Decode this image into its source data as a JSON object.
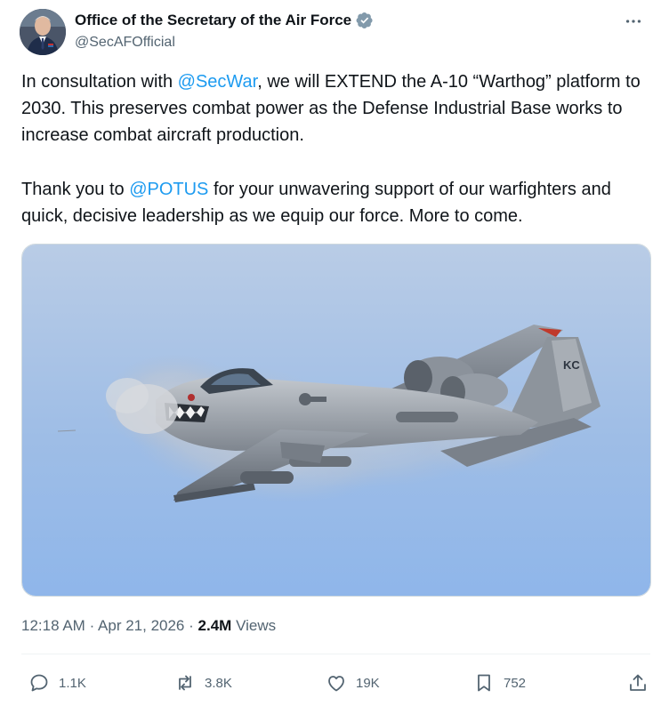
{
  "post": {
    "author": {
      "display_name": "Office of the Secretary of the Air Force",
      "handle": "@SecAFOfficial",
      "verified_color": "#829aab"
    },
    "text": {
      "p1_a": "In consultation with ",
      "p1_mention": "@SecWar",
      "p1_b": ", we will EXTEND the A-10 “Warthog” platform to 2030. This preserves combat power as the Defense Industrial Base works to increase combat aircraft production.",
      "p2_a": "Thank you to ",
      "p2_mention": "@POTUS",
      "p2_b": " for your unwavering support of our warfighters and quick, decisive leadership as we equip our force. More to come."
    },
    "media": {
      "icon": "aircraft-photo",
      "tail_code": "KC"
    },
    "meta": {
      "time": "12:18 AM",
      "separator": "·",
      "date": "Apr 21, 2026",
      "views_count": "2.4M",
      "views_label": "Views"
    },
    "actions": {
      "reply": "1.1K",
      "repost": "3.8K",
      "like": "19K",
      "bookmark": "752"
    },
    "colors": {
      "link": "#1d9bf0",
      "secondary_text": "#536471",
      "primary_text": "#0f1419"
    }
  }
}
